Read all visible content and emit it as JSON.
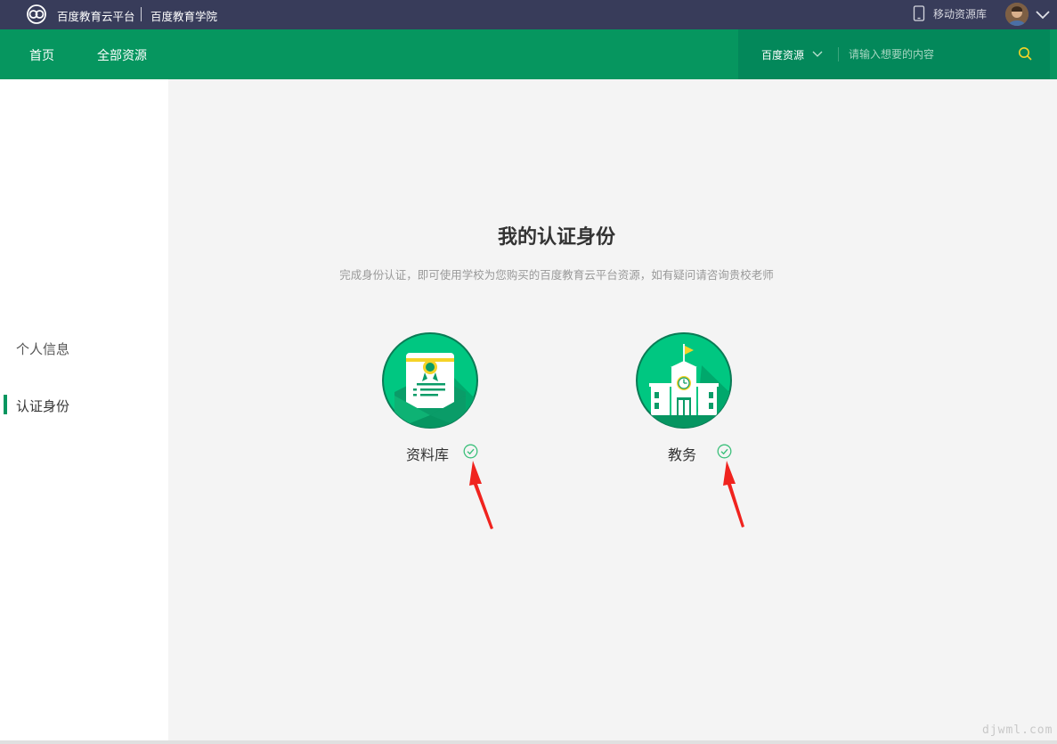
{
  "topbar": {
    "brand": "百度教育云平台",
    "sub_brand": "百度教育学院",
    "mobile_label": "移动资源库",
    "logo_icon": "cloud-logo-icon",
    "mobile_icon": "tablet-icon",
    "caret_icon": "chevron-down-icon"
  },
  "nav": {
    "items": [
      {
        "label": "首页"
      },
      {
        "label": "全部资源"
      }
    ],
    "search": {
      "scope_label": "百度资源",
      "placeholder": "请输入想要的内容"
    }
  },
  "sidebar": {
    "items": [
      {
        "label": "个人信息",
        "active": false
      },
      {
        "label": "认证身份",
        "active": true
      }
    ]
  },
  "main": {
    "title": "我的认证身份",
    "subtitle": "完成身份认证，即可使用学校为您购买的百度教育云平台资源，如有疑问请咨询贵校老师",
    "identities": [
      {
        "label": "资料库",
        "icon": "certificate-envelope-icon",
        "verified": true
      },
      {
        "label": "教务",
        "icon": "school-building-icon",
        "verified": true
      }
    ]
  },
  "watermark": "djwml.com",
  "colors": {
    "topbar": "#383c5a",
    "nav_green": "#06965f",
    "accent_green": "#00c781",
    "check_green": "#3cc07b",
    "annotation_red": "#f0231e",
    "content_bg": "#f4f4f4"
  }
}
